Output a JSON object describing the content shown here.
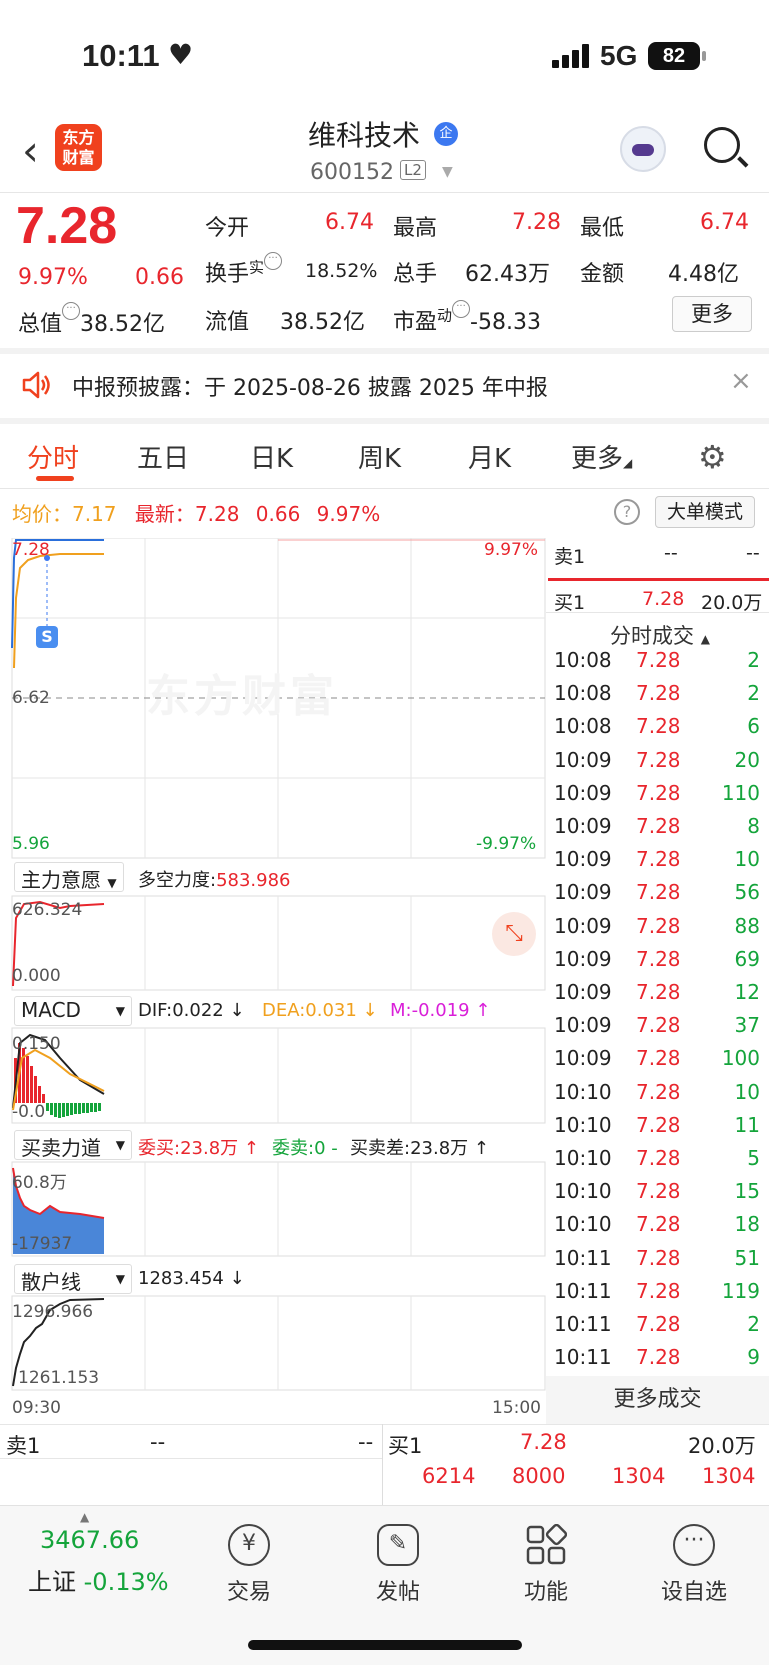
{
  "status_bar": {
    "time": "10:11",
    "network": "5G",
    "battery": "82"
  },
  "header": {
    "stock_name": "维科技术",
    "badge": "企",
    "code": "600152",
    "level": "L2",
    "logo_text": "东方\n财富"
  },
  "quote": {
    "price": "7.28",
    "change_pct": "9.97%",
    "change": "0.66",
    "open_label": "今开",
    "open": "6.74",
    "high_label": "最高",
    "high": "7.28",
    "low_label": "最低",
    "low": "6.74",
    "turnover_label": "换手",
    "turnover_sup": "实",
    "turnover": "18.52%",
    "volume_label": "总手",
    "volume": "62.43万",
    "amount_label": "金额",
    "amount": "4.48亿",
    "mktcap_label": "总值",
    "mktcap": "38.52亿",
    "float_label": "流值",
    "float_value": "38.52亿",
    "pe_label": "市盈",
    "pe_sup": "动",
    "pe": "-58.33",
    "more_button": "更多"
  },
  "notice": {
    "text": "中报预披露：于 2025-08-26 披露 2025 年中报"
  },
  "tabs": [
    "分时",
    "五日",
    "日K",
    "周K",
    "月K",
    "更多"
  ],
  "info_line": {
    "avg_label": "均价：",
    "avg": "7.17",
    "latest_label": "最新：",
    "latest": "7.28",
    "change": "0.66",
    "change_pct": "9.97%",
    "big_order_mode": "大单模式"
  },
  "main_chart": {
    "y_top": "7.28",
    "y_mid": "6.62",
    "y_bottom": "5.96",
    "pct_top": "9.97%",
    "pct_bottom": "-9.97%",
    "watermark": "东方财富",
    "marker": "S",
    "x_start": "09:30",
    "x_end": "15:00"
  },
  "indicators": {
    "main_force": {
      "name": "主力意愿",
      "label": "多空力度:",
      "value": "583.986",
      "top": "626.324",
      "bottom": "0.000"
    },
    "macd": {
      "name": "MACD",
      "dif": "DIF:0.022 ↓",
      "dea": "DEA:0.031 ↓",
      "m": "M:-0.019 ↑",
      "top": "0.150",
      "bottom": "-0.0"
    },
    "buysell": {
      "name": "买卖力道",
      "buy": "委买:23.8万 ↑",
      "sell": "委卖:0 -",
      "diff": "买卖差:23.8万 ↑",
      "top": "60.8万",
      "bottom": "-17937"
    },
    "retail": {
      "name": "散户线",
      "value": "1283.454 ↓",
      "top": "1296.966",
      "bottom": "1261.153"
    }
  },
  "side_book": {
    "sell1": {
      "label": "卖1",
      "price": "--",
      "vol": "--"
    },
    "buy1": {
      "label": "买1",
      "price": "7.28",
      "vol": "20.0万"
    },
    "title": "分时成交",
    "more": "更多成交"
  },
  "trades": [
    {
      "time": "10:08",
      "price": "7.28",
      "vol": "2"
    },
    {
      "time": "10:08",
      "price": "7.28",
      "vol": "2"
    },
    {
      "time": "10:08",
      "price": "7.28",
      "vol": "6"
    },
    {
      "time": "10:09",
      "price": "7.28",
      "vol": "20"
    },
    {
      "time": "10:09",
      "price": "7.28",
      "vol": "110"
    },
    {
      "time": "10:09",
      "price": "7.28",
      "vol": "8"
    },
    {
      "time": "10:09",
      "price": "7.28",
      "vol": "10"
    },
    {
      "time": "10:09",
      "price": "7.28",
      "vol": "56"
    },
    {
      "time": "10:09",
      "price": "7.28",
      "vol": "88"
    },
    {
      "time": "10:09",
      "price": "7.28",
      "vol": "69"
    },
    {
      "time": "10:09",
      "price": "7.28",
      "vol": "12"
    },
    {
      "time": "10:09",
      "price": "7.28",
      "vol": "37"
    },
    {
      "time": "10:09",
      "price": "7.28",
      "vol": "100"
    },
    {
      "time": "10:10",
      "price": "7.28",
      "vol": "10"
    },
    {
      "time": "10:10",
      "price": "7.28",
      "vol": "11"
    },
    {
      "time": "10:10",
      "price": "7.28",
      "vol": "5"
    },
    {
      "time": "10:10",
      "price": "7.28",
      "vol": "15"
    },
    {
      "time": "10:10",
      "price": "7.28",
      "vol": "18"
    },
    {
      "time": "10:11",
      "price": "7.28",
      "vol": "51"
    },
    {
      "time": "10:11",
      "price": "7.28",
      "vol": "119"
    },
    {
      "time": "10:11",
      "price": "7.28",
      "vol": "2"
    },
    {
      "time": "10:11",
      "price": "7.28",
      "vol": "9"
    }
  ],
  "bottom_book": {
    "sell1_label": "卖1",
    "sell1_price": "--",
    "sell1_vol": "--",
    "buy1_label": "买1",
    "buy1_price": "7.28",
    "buy1_vol": "20.0万",
    "orders": [
      "6214",
      "8000",
      "1304",
      "1304"
    ]
  },
  "bottom_nav": {
    "index_value": "3467.66",
    "index_name": "上证",
    "index_change": "-0.13%",
    "items": [
      "交易",
      "发帖",
      "功能",
      "设自选"
    ]
  }
}
